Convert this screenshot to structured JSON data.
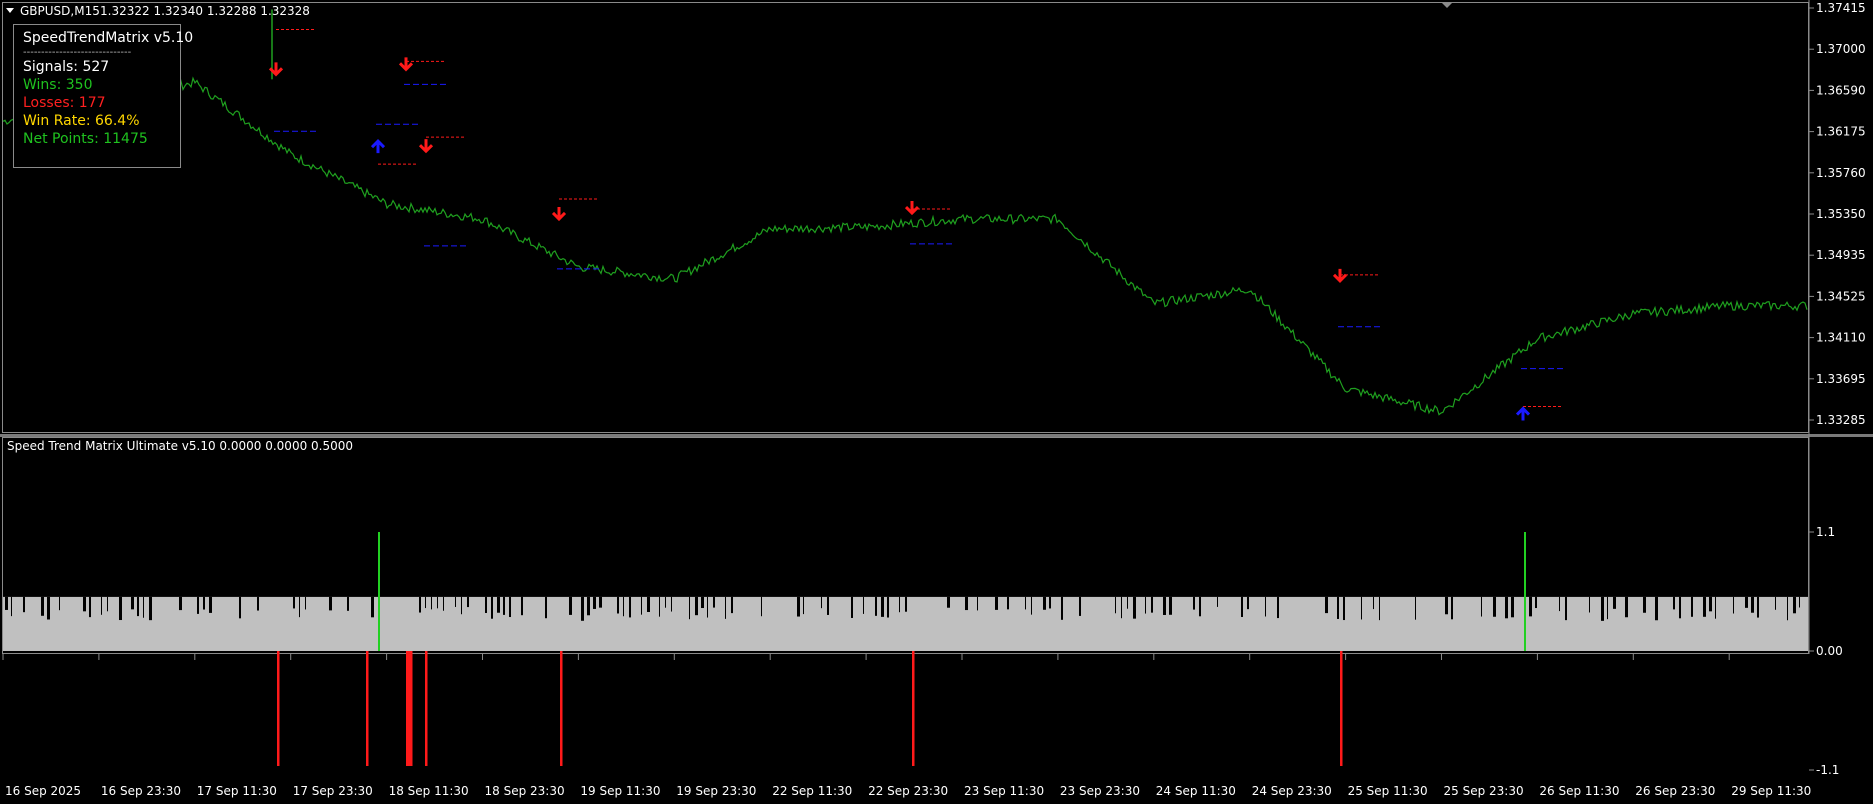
{
  "header": {
    "symbol": "GBPUSD,M15",
    "quotes": "1.32322 1.32340 1.32288 1.32328"
  },
  "stats_panel": {
    "title": "SpeedTrendMatrix v5.10",
    "divider": "------------------------------",
    "signals": "Signals: 527",
    "wins": "Wins: 350",
    "losses": "Losses: 177",
    "win_rate": "Win Rate: 66.4%",
    "net_points": "Net Points: 11475",
    "colors": {
      "title": "#ffffff",
      "signals": "#ffffff",
      "wins": "#1fc21f",
      "losses": "#ff2020",
      "win_rate": "#ffd700",
      "net_points": "#1fc21f"
    }
  },
  "indicator": {
    "title": "Speed Trend Matrix Ultimate v5.10 0.0000 0.0000 0.5000",
    "axis_labels": [
      "1.1",
      "0.00",
      "-1.1"
    ]
  },
  "price_axis": {
    "labels": [
      "1.37415",
      "1.37000",
      "1.36590",
      "1.36175",
      "1.35760",
      "1.35350",
      "1.34935",
      "1.34525",
      "1.34110",
      "1.33695",
      "1.33285"
    ]
  },
  "time_axis": {
    "labels": [
      "16 Sep 2025",
      "16 Sep 23:30",
      "17 Sep 11:30",
      "17 Sep 23:30",
      "18 Sep 11:30",
      "18 Sep 23:30",
      "19 Sep 11:30",
      "19 Sep 23:30",
      "22 Sep 11:30",
      "22 Sep 23:30",
      "23 Sep 11:30",
      "23 Sep 23:30",
      "24 Sep 11:30",
      "24 Sep 23:30",
      "25 Sep 11:30",
      "25 Sep 23:30",
      "26 Sep 11:30",
      "26 Sep 23:30",
      "29 Sep 11:30"
    ]
  },
  "colors": {
    "background": "#000000",
    "price_line": "#1fa01f",
    "sell_arrow": "#ff1a1a",
    "buy_arrow": "#1a1aff",
    "histogram_band": "#c0c0c0",
    "sell_bar": "#ff1a1a",
    "buy_bar": "#22d022",
    "frame": "#8a8a8a"
  },
  "chart_data": {
    "type": "line",
    "title": "GBPUSD,M15",
    "ylim": [
      1.3313,
      1.375
    ],
    "price_path": [
      [
        "16 Sep 2025",
        1.3628
      ],
      [
        "16 Sep 23:30",
        1.3645
      ],
      [
        "17 Sep 11:30",
        1.3667
      ],
      [
        "17 Sep 23:30",
        1.3595
      ],
      [
        "18 Sep 11:30",
        1.3545
      ],
      [
        "18 Sep 23:30",
        1.353
      ],
      [
        "19 Sep 11:30",
        1.3482
      ],
      [
        "19 Sep 23:30",
        1.347
      ],
      [
        "22 Sep 11:30",
        1.352
      ],
      [
        "22 Sep 23:30",
        1.3522
      ],
      [
        "23 Sep 11:30",
        1.353
      ],
      [
        "23 Sep 23:30",
        1.353
      ],
      [
        "24 Sep 11:30",
        1.3445
      ],
      [
        "24 Sep 23:30",
        1.346
      ],
      [
        "25 Sep 11:30",
        1.336
      ],
      [
        "25 Sep 23:30",
        1.3337
      ],
      [
        "26 Sep 11:30",
        1.341
      ],
      [
        "26 Sep 23:30",
        1.3435
      ],
      [
        "29 Sep 11:30",
        1.3443
      ]
    ],
    "signals": [
      {
        "dir": "sell",
        "price": 1.3675,
        "sl": 1.372,
        "tp": 1.3618
      },
      {
        "dir": "sell",
        "price": 1.368,
        "sl": 1.3688,
        "tp": 1.3665
      },
      {
        "dir": "buy",
        "price": 1.3608,
        "sl": 1.3585,
        "tp": 1.3625
      },
      {
        "dir": "sell",
        "price": 1.3598,
        "sl": 1.3612,
        "tp": 1.3503
      },
      {
        "dir": "sell",
        "price": 1.353,
        "sl": 1.355,
        "tp": 1.348
      },
      {
        "dir": "sell",
        "price": 1.3536,
        "sl": 1.354,
        "tp": 1.3505
      },
      {
        "dir": "sell",
        "price": 1.3468,
        "sl": 1.3474,
        "tp": 1.3422
      },
      {
        "dir": "buy",
        "price": 1.334,
        "sl": 1.3342,
        "tp": 1.338
      }
    ],
    "oscillator": {
      "ylim": [
        -1.1,
        1.1
      ],
      "band_value": 0.5,
      "sell_bars": [
        -1,
        -1,
        -1,
        -1,
        -1,
        -1,
        -1
      ],
      "buy_bars": [
        1.05,
        1.05
      ]
    }
  }
}
